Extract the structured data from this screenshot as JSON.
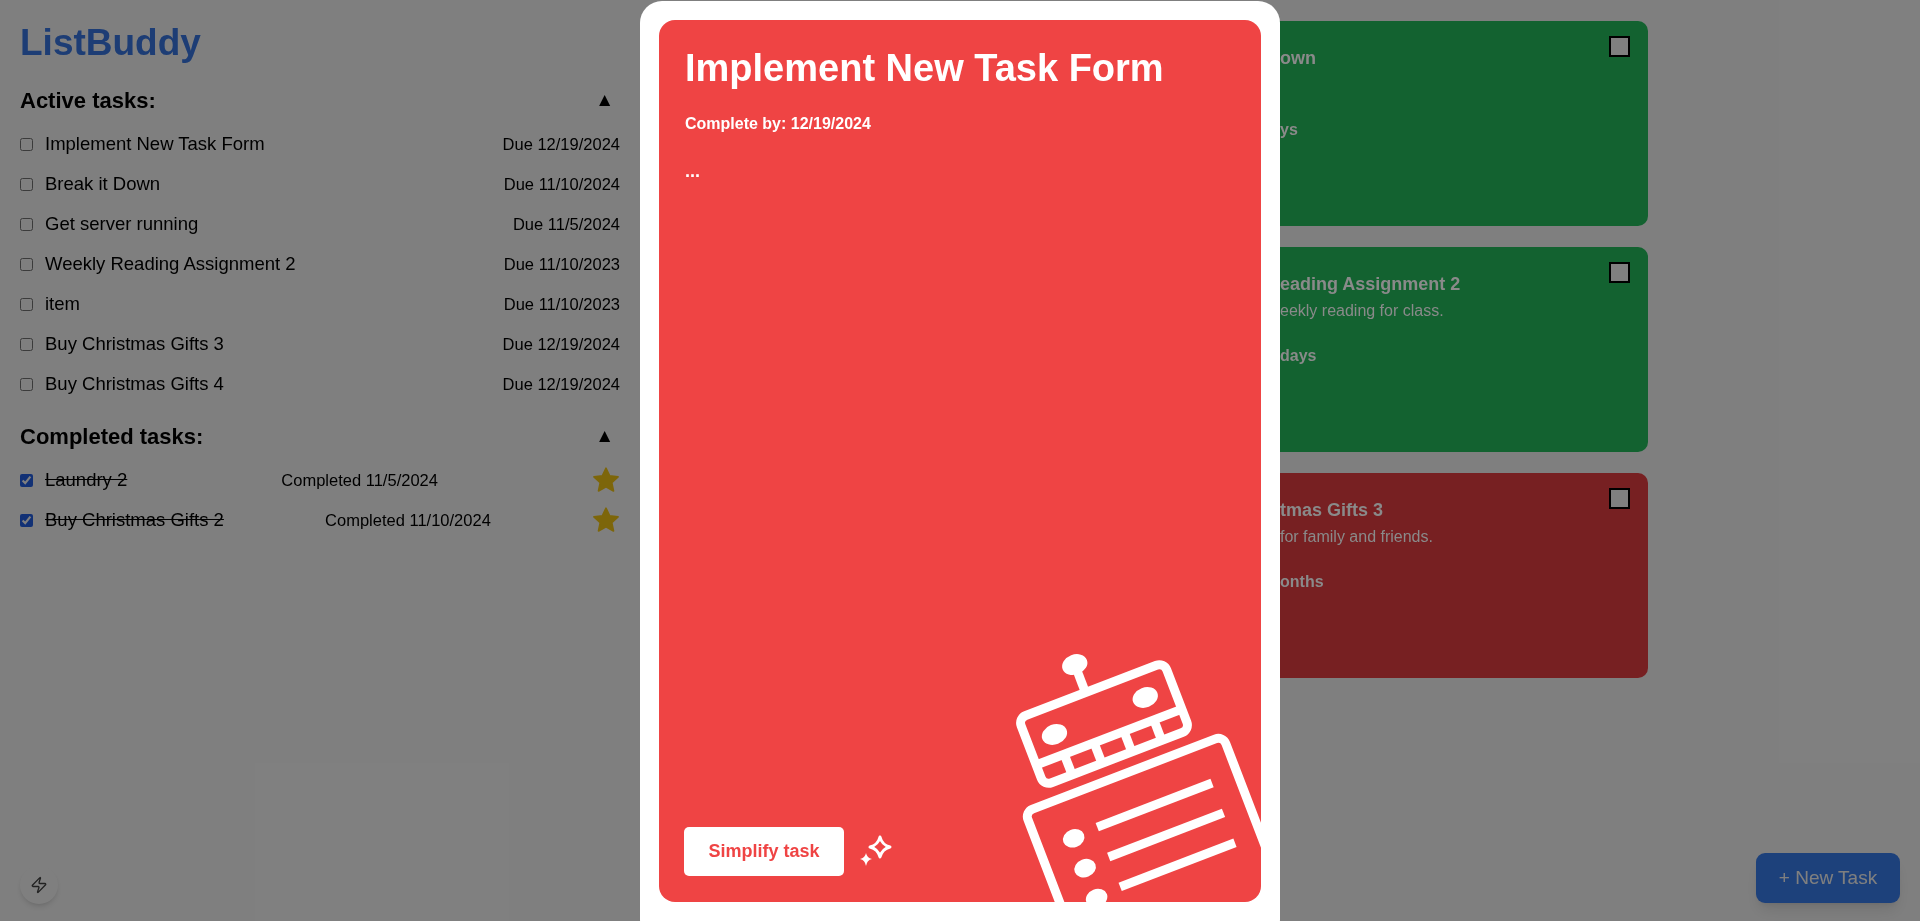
{
  "app_title": "ListBuddy",
  "sections": [
    {
      "heading": "Active tasks:",
      "toggle": "▲",
      "expanded": true,
      "tasks": [
        {
          "name": "Implement New Task Form",
          "date": "Due 12/19/2024",
          "checked": false
        },
        {
          "name": "Break it Down",
          "date": "Due 11/10/2024",
          "checked": false
        },
        {
          "name": "Get server running",
          "date": "Due 11/5/2024",
          "checked": false
        },
        {
          "name": "Weekly Reading Assignment 2",
          "date": "Due 11/10/2023",
          "checked": false
        },
        {
          "name": "item",
          "date": "Due 11/10/2023",
          "checked": false
        },
        {
          "name": "Buy Christmas Gifts 3",
          "date": "Due 12/19/2024",
          "checked": false
        },
        {
          "name": "Buy Christmas Gifts 4",
          "date": "Due 12/19/2024",
          "checked": false
        }
      ]
    },
    {
      "heading": "Completed tasks:",
      "toggle": "▲",
      "expanded": true,
      "tasks": [
        {
          "name": "Laundry 2",
          "date": "Completed 11/5/2024",
          "checked": true,
          "starred": true
        },
        {
          "name": "Buy Christmas Gifts 2",
          "date": "Completed 11/10/2024",
          "checked": true,
          "starred": true
        }
      ]
    }
  ],
  "cards": [
    {
      "title": "own",
      "remaining": "ys",
      "checked": false,
      "color": "#136230"
    },
    {
      "title": "eading Assignment 2",
      "description": "eekly reading for class.",
      "remaining": "days",
      "checked": false,
      "color": "#136230"
    },
    {
      "title": "tmas Gifts 3",
      "description": "for family and friends.",
      "remaining": "onths",
      "checked": false,
      "color": "#772022"
    }
  ],
  "modal": {
    "title": "Implement New Task Form",
    "complete_by": "Complete by: 12/19/2024",
    "body": "...",
    "action": "Simplify task",
    "color": "#ef4444"
  },
  "new_task_button": "+ New Task"
}
